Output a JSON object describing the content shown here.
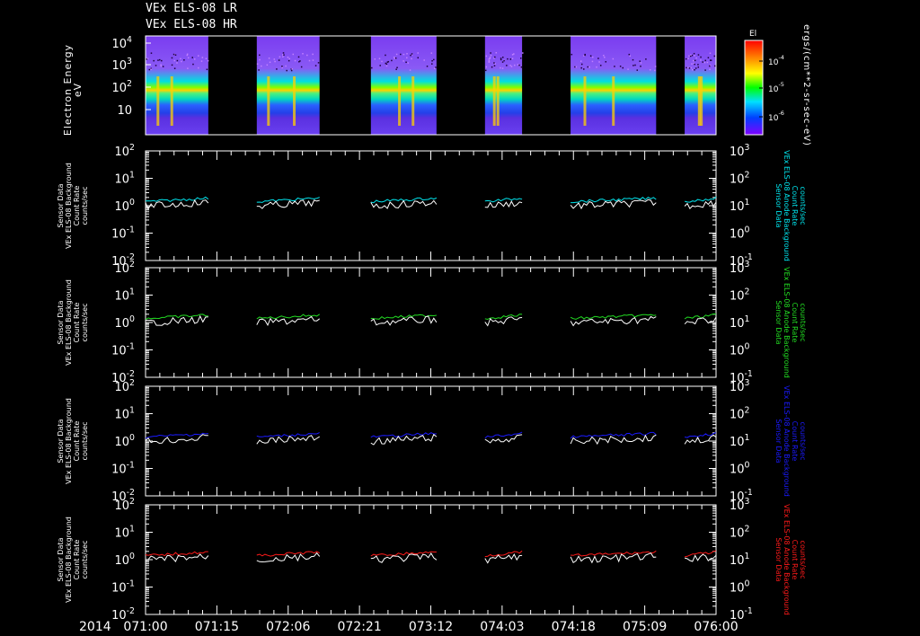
{
  "header": {
    "title1": "VEx ELS-08 LR",
    "title2": "VEx ELS-08 HR"
  },
  "year": "2014",
  "x_ticks": [
    "071:00",
    "071:15",
    "072:06",
    "072:21",
    "073:12",
    "074:03",
    "074:18",
    "075:09",
    "076:00"
  ],
  "colors": {
    "cyan": "#00e5ee",
    "green": "#22dd22",
    "blue": "#1a1aff",
    "red": "#ff1a1a",
    "white": "#ffffff"
  },
  "chart_data": [
    {
      "type": "heatmap",
      "ylabel": "Electron Energy",
      "yunit": "eV",
      "yticks": [
        "10",
        "10^2",
        "10^3",
        "10^4"
      ],
      "colorbar_title": "El",
      "colorbar_ticks": [
        "10^-4",
        "10^-5",
        "10^-6"
      ],
      "colorbar_label": "ergs/(cm**2-sr-sec-eV)",
      "scale": "log",
      "data_segments": [
        [
          0.0,
          0.11
        ],
        [
          0.195,
          0.305
        ],
        [
          0.395,
          0.51
        ],
        [
          0.595,
          0.66
        ],
        [
          0.745,
          0.895
        ],
        [
          0.945,
          1.0
        ]
      ]
    },
    {
      "type": "line",
      "left_label": [
        "Sensor Data",
        "VEx ELS-08 Background",
        "Count Rate",
        "counts/sec"
      ],
      "right_label": [
        "Sensor Data",
        "VEx ELS-08 Anode Background",
        "Count Rate",
        "counts/sec"
      ],
      "left_ticks": [
        "10^-2",
        "10^-1",
        "10^0",
        "10^1",
        "10^2"
      ],
      "right_ticks": [
        "10^-1",
        "10^0",
        "10^1",
        "10^2",
        "10^3"
      ],
      "scale": "log",
      "series": [
        {
          "color": "cyan",
          "level": 1.4
        },
        {
          "color": "white",
          "level": 1.1
        }
      ]
    },
    {
      "type": "line",
      "left_label": [
        "Sensor Data",
        "VEx ELS-08 Background",
        "Count Rate",
        "counts/sec"
      ],
      "right_label": [
        "Sensor Data",
        "VEx ELS-08 Anode Background",
        "Count Rate",
        "counts/sec"
      ],
      "left_ticks": [
        "10^-2",
        "10^-1",
        "10^0",
        "10^1",
        "10^2"
      ],
      "right_ticks": [
        "10^-1",
        "10^0",
        "10^1",
        "10^2",
        "10^3"
      ],
      "scale": "log",
      "series": [
        {
          "color": "green",
          "level": 1.4
        },
        {
          "color": "white",
          "level": 1.1
        }
      ]
    },
    {
      "type": "line",
      "left_label": [
        "Sensor Data",
        "VEx ELS-08 Background",
        "Count Rate",
        "counts/sec"
      ],
      "right_label": [
        "Sensor Data",
        "VEx ELS-08 Anode Background",
        "Count Rate",
        "counts/sec"
      ],
      "left_ticks": [
        "10^-2",
        "10^-1",
        "10^0",
        "10^1",
        "10^2"
      ],
      "right_ticks": [
        "10^-1",
        "10^0",
        "10^1",
        "10^2",
        "10^3"
      ],
      "scale": "log",
      "series": [
        {
          "color": "blue",
          "level": 1.4
        },
        {
          "color": "white",
          "level": 1.1
        }
      ]
    },
    {
      "type": "line",
      "left_label": [
        "Sensor Data",
        "VEx ELS-08 Background",
        "Count Rate",
        "counts/sec"
      ],
      "right_label": [
        "Sensor Data",
        "VEx ELS-08 Anode Background",
        "Count Rate",
        "counts/sec"
      ],
      "left_ticks": [
        "10^-2",
        "10^-1",
        "10^0",
        "10^1",
        "10^2"
      ],
      "right_ticks": [
        "10^-1",
        "10^0",
        "10^1",
        "10^2",
        "10^3"
      ],
      "scale": "log",
      "series": [
        {
          "color": "red",
          "level": 1.4
        },
        {
          "color": "white",
          "level": 1.1
        }
      ]
    }
  ]
}
